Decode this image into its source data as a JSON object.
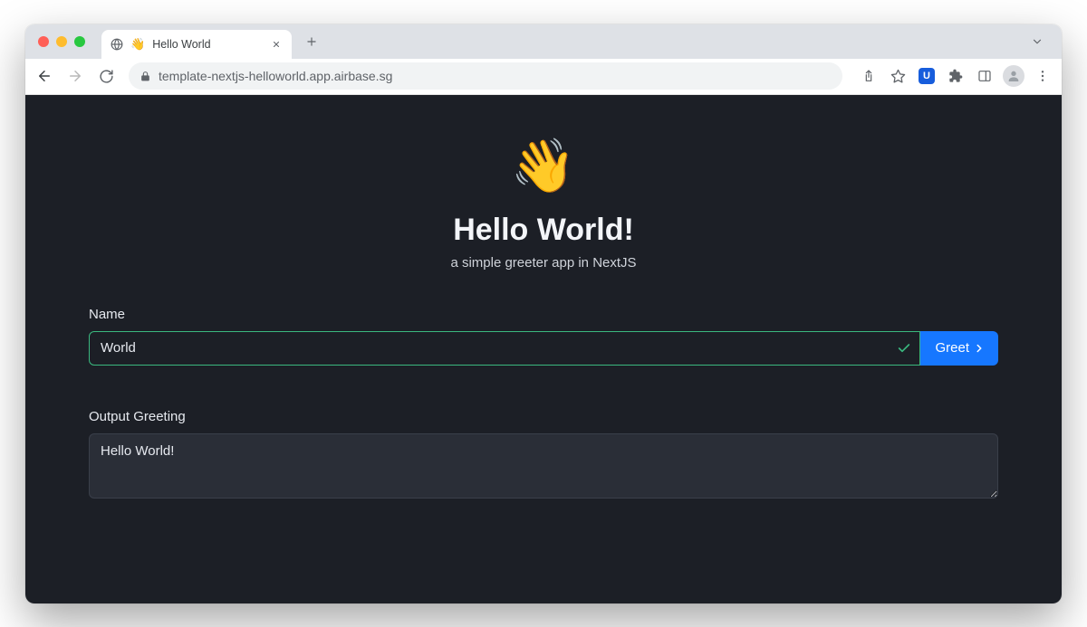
{
  "browser": {
    "tab": {
      "favicon": "👋",
      "title": "Hello World"
    },
    "url": "template-nextjs-helloworld.app.airbase.sg"
  },
  "hero": {
    "emoji": "👋",
    "title": "Hello World!",
    "subtitle": "a simple greeter app in NextJS"
  },
  "form": {
    "name_label": "Name",
    "name_value": "World",
    "greet_button_label": "Greet"
  },
  "output": {
    "label": "Output Greeting",
    "value": "Hello World!"
  },
  "colors": {
    "page_bg": "#1c1f26",
    "accent_btn": "#1677ff",
    "input_border_valid": "#3ab87f"
  }
}
